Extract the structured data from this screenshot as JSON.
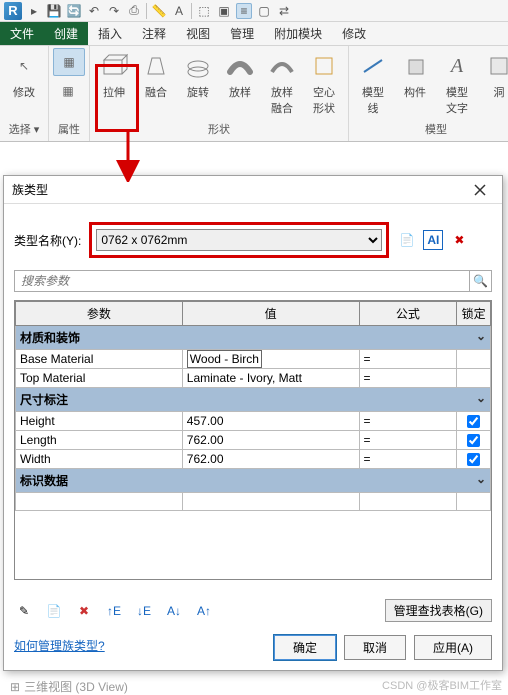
{
  "qat_logo": "R",
  "tabs": {
    "file": "文件",
    "create": "创建",
    "insert": "插入",
    "annotate": "注释",
    "view": "视图",
    "manage": "管理",
    "addins": "附加模块",
    "modify": "修改"
  },
  "ribbon": {
    "select": {
      "modify": "修改",
      "selectTitle": "选择 ▾",
      "propTitle": "属性"
    },
    "shapes": {
      "extrude": "拉伸",
      "blend": "融合",
      "revolve": "旋转",
      "sweep": "放样",
      "sweptblend": "放样\n融合",
      "void": "空心\n形状",
      "title": "形状"
    },
    "model": {
      "modelline": "模型\n线",
      "component": "构件",
      "modeltext": "模型\n文字",
      "title": "模型",
      "opening": "洞"
    }
  },
  "dlg": {
    "title": "族类型",
    "nameLabel": "类型名称(Y):",
    "typeName": "0762 x 0762mm",
    "searchPlaceholder": "搜索参数",
    "cols": {
      "param": "参数",
      "value": "值",
      "formula": "公式",
      "lock": "锁定"
    },
    "cats": {
      "mat": "材质和装饰",
      "dim": "尺寸标注",
      "id": "标识数据"
    },
    "rows": {
      "baseMat": {
        "p": "Base Material",
        "v": "Wood - Birch",
        "f": "="
      },
      "topMat": {
        "p": "Top Material",
        "v": "Laminate - Ivory, Matt",
        "f": "="
      },
      "height": {
        "p": "Height",
        "v": "457.00",
        "f": "="
      },
      "length": {
        "p": "Length",
        "v": "762.00",
        "f": "="
      },
      "width": {
        "p": "Width",
        "v": "762.00",
        "f": "="
      }
    },
    "manage": "管理查找表格(G)",
    "howto": "如何管理族类型?",
    "ok": "确定",
    "cancel": "取消",
    "apply": "应用(A)"
  },
  "watermark": "CSDN @极客BIM工作室",
  "treefoot": "三维视图 (3D View)"
}
